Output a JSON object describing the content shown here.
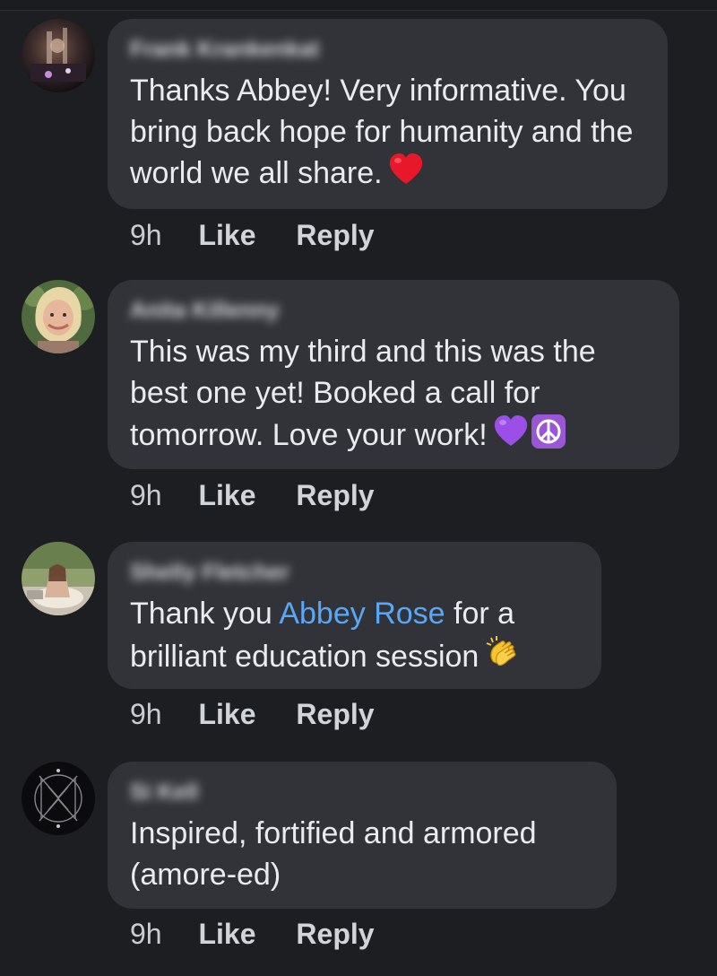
{
  "comments": [
    {
      "author": "Frank Krankenkat",
      "text": "Thanks Abbey!  Very informative. You bring back hope for humanity and the world we all share.",
      "emoji_icons": [
        "red-heart-icon"
      ],
      "time": "9h",
      "like_label": "Like",
      "reply_label": "Reply"
    },
    {
      "author": "Anita Killenny",
      "text": "This was my third and this was the best one yet!  Booked a call for tomorrow. Love your work!",
      "emoji_icons": [
        "purple-heart-icon",
        "peace-symbol-icon"
      ],
      "time": "9h",
      "like_label": "Like",
      "reply_label": "Reply"
    },
    {
      "author": "Shelly Fletcher",
      "text_before": "Thank you ",
      "mention": "Abbey Rose",
      "text_after": " for a brilliant education session",
      "emoji_icons": [
        "clapping-hands-icon"
      ],
      "time": "9h",
      "like_label": "Like",
      "reply_label": "Reply"
    },
    {
      "author": "Si Kell",
      "text": "Inspired, fortified and armored (amore-ed)",
      "time": "9h",
      "like_label": "Like",
      "reply_label": "Reply"
    }
  ],
  "colors": {
    "background": "#1c1e22",
    "bubble": "#323338",
    "mention": "#5aa7f7",
    "meta_text": "#c9ccd1"
  }
}
